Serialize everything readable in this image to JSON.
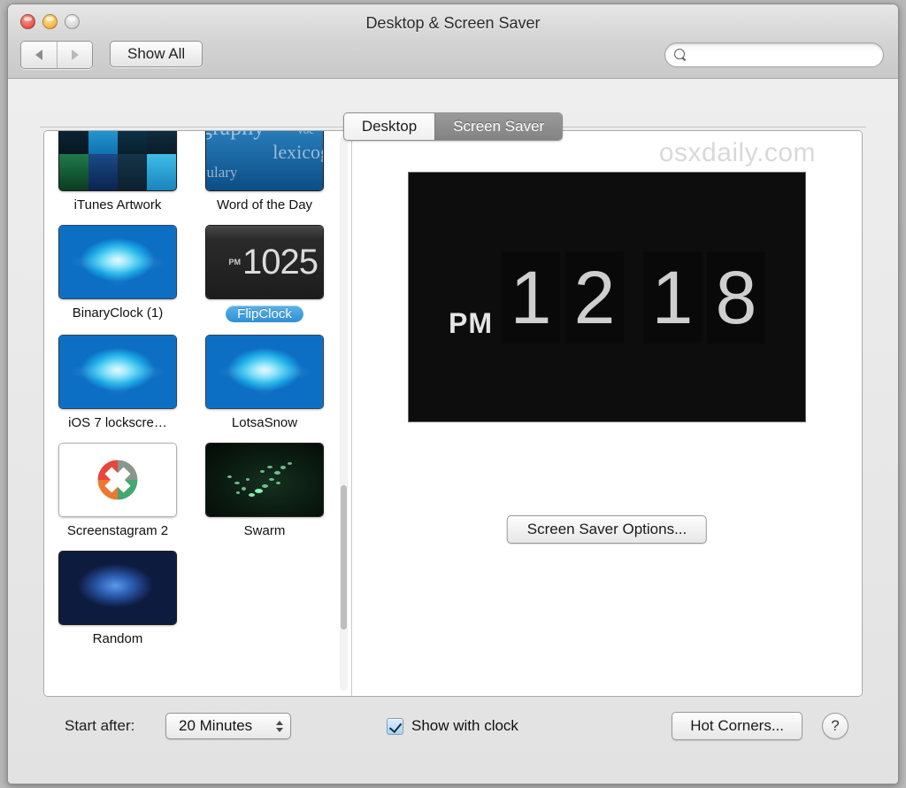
{
  "window": {
    "title": "Desktop & Screen Saver",
    "traffic_lights": [
      "close-button",
      "minimize-button",
      "zoom-button"
    ]
  },
  "toolbar": {
    "back_label": "",
    "forward_label": "",
    "show_all_label": "Show All",
    "search_placeholder": "",
    "search_value": ""
  },
  "tabs": [
    {
      "label": "Desktop",
      "active": false
    },
    {
      "label": "Screen Saver",
      "active": true
    }
  ],
  "screensavers": [
    {
      "label": "iTunes Artwork",
      "art": "itunes",
      "selected": false
    },
    {
      "label": "Word of the Day",
      "art": "wotd",
      "selected": false
    },
    {
      "label": "BinaryClock (1)",
      "art": "swirl",
      "selected": false
    },
    {
      "label": "FlipClock",
      "art": "flip",
      "selected": true
    },
    {
      "label": "iOS 7 lockscre…",
      "art": "swirl",
      "selected": false
    },
    {
      "label": "LotsaSnow",
      "art": "swirl",
      "selected": false
    },
    {
      "label": "Screenstagram 2",
      "art": "insta",
      "selected": false
    },
    {
      "label": "Swarm",
      "art": "swarm",
      "selected": false
    },
    {
      "label": "Random",
      "art": "swirl-dark",
      "selected": false
    }
  ],
  "thumb_flipclock": {
    "ampm": "PM",
    "digits": "1025"
  },
  "wotd_words": [
    "graphy",
    "voc",
    "lexicog",
    "bulary"
  ],
  "preview": {
    "watermark": "osxdaily.com",
    "clock": {
      "ampm": "PM",
      "digits": [
        "1",
        "2",
        "1",
        "8"
      ]
    },
    "options_button": "Screen Saver Options..."
  },
  "bottom": {
    "start_after_label": "Start after:",
    "start_after_value": "20 Minutes",
    "show_with_clock_label": "Show with clock",
    "show_with_clock_checked": true,
    "hot_corners_label": "Hot Corners...",
    "help_label": "?"
  },
  "colors": {
    "selection_blue": "#2f8fd4",
    "tab_active_gray": "#8b8b8b",
    "preview_black": "#0d0d0d",
    "watermark_gray": "#d9d9d9"
  }
}
